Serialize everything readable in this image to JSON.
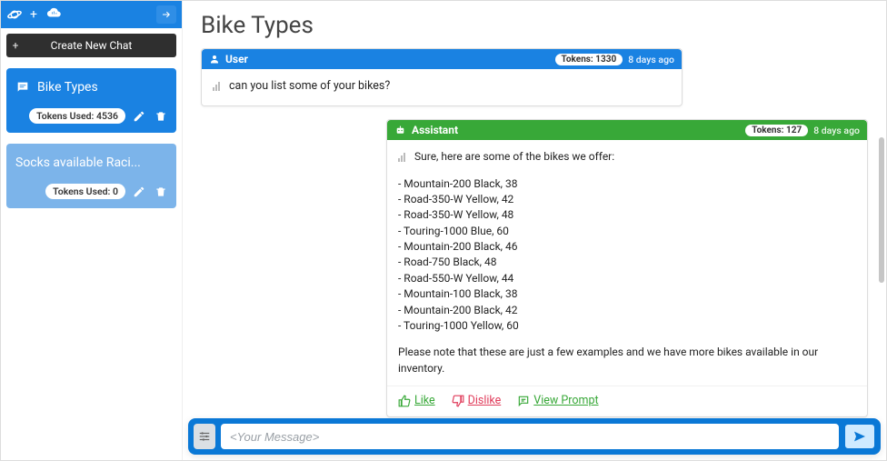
{
  "sidebar": {
    "newChatLabel": "Create New Chat",
    "chats": [
      {
        "title": "Bike Types",
        "tokensLabel": "Tokens Used: 4536"
      },
      {
        "title": "Socks available Raci...",
        "tokensLabel": "Tokens Used: 0"
      }
    ]
  },
  "page": {
    "title": "Bike Types"
  },
  "messages": {
    "user": {
      "role": "User",
      "tokens": "Tokens: 1330",
      "time": "8 days ago",
      "text": "can you list some of your bikes?"
    },
    "assistant": {
      "role": "Assistant",
      "tokens": "Tokens: 127",
      "time": "8 days ago",
      "intro": "Sure, here are some of the bikes we offer:",
      "items": [
        "- Mountain-200 Black, 38",
        "- Road-350-W Yellow, 42",
        "- Road-350-W Yellow, 48",
        "- Touring-1000 Blue, 60",
        "- Mountain-200 Black, 46",
        "- Road-750 Black, 48",
        "- Road-550-W Yellow, 44",
        "- Mountain-100 Black, 38",
        "- Mountain-200 Black, 42",
        "- Touring-1000 Yellow, 60"
      ],
      "note": "Please note that these are just a few examples and we have more bikes available in our inventory.",
      "actions": {
        "like": "Like",
        "dislike": "Dislike",
        "viewPrompt": "View Prompt"
      }
    }
  },
  "composer": {
    "placeholder": "<Your Message>"
  }
}
